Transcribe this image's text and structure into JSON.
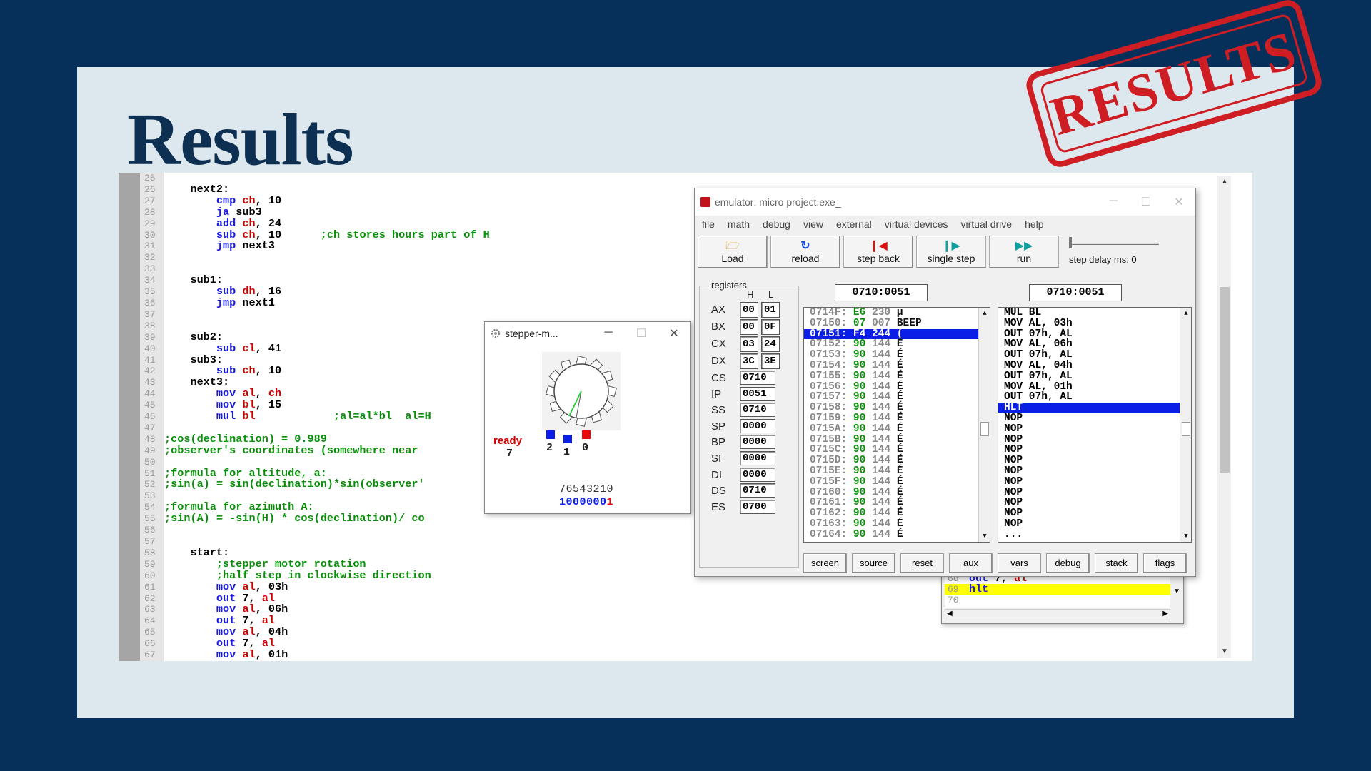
{
  "slide": {
    "title": "Results",
    "stamp": "RESULTS"
  },
  "colors": {
    "background": "#06305a",
    "slide": "#dde7ee",
    "title": "#0d2f52",
    "stamp": "#cf1d24"
  },
  "editor": {
    "lines": [
      {
        "n": "25",
        "parts": []
      },
      {
        "n": "26",
        "parts": [
          [
            "lbl",
            "    next2:"
          ]
        ]
      },
      {
        "n": "27",
        "parts": [
          [
            "txt",
            "        "
          ],
          [
            "kw",
            "cmp"
          ],
          [
            "txt",
            " "
          ],
          [
            "reg",
            "ch"
          ],
          [
            "txt",
            ", 10"
          ]
        ]
      },
      {
        "n": "28",
        "parts": [
          [
            "txt",
            "        "
          ],
          [
            "kw",
            "ja"
          ],
          [
            "txt",
            " sub3"
          ]
        ]
      },
      {
        "n": "29",
        "parts": [
          [
            "txt",
            "        "
          ],
          [
            "kw",
            "add"
          ],
          [
            "txt",
            " "
          ],
          [
            "reg",
            "ch"
          ],
          [
            "txt",
            ", 24"
          ]
        ]
      },
      {
        "n": "30",
        "parts": [
          [
            "txt",
            "        "
          ],
          [
            "kw",
            "sub"
          ],
          [
            "txt",
            " "
          ],
          [
            "reg",
            "ch"
          ],
          [
            "txt",
            ", 10      "
          ],
          [
            "com",
            ";ch stores hours part of H"
          ]
        ]
      },
      {
        "n": "31",
        "parts": [
          [
            "txt",
            "        "
          ],
          [
            "kw",
            "jmp"
          ],
          [
            "txt",
            " next3"
          ]
        ]
      },
      {
        "n": "32",
        "parts": []
      },
      {
        "n": "33",
        "parts": []
      },
      {
        "n": "34",
        "parts": [
          [
            "lbl",
            "    sub1:"
          ]
        ]
      },
      {
        "n": "35",
        "parts": [
          [
            "txt",
            "        "
          ],
          [
            "kw",
            "sub"
          ],
          [
            "txt",
            " "
          ],
          [
            "reg",
            "dh"
          ],
          [
            "txt",
            ", 16"
          ]
        ]
      },
      {
        "n": "36",
        "parts": [
          [
            "txt",
            "        "
          ],
          [
            "kw",
            "jmp"
          ],
          [
            "txt",
            " next1"
          ]
        ]
      },
      {
        "n": "37",
        "parts": []
      },
      {
        "n": "38",
        "parts": []
      },
      {
        "n": "39",
        "parts": [
          [
            "lbl",
            "    sub2:"
          ]
        ]
      },
      {
        "n": "40",
        "parts": [
          [
            "txt",
            "        "
          ],
          [
            "kw",
            "sub"
          ],
          [
            "txt",
            " "
          ],
          [
            "reg",
            "cl"
          ],
          [
            "txt",
            ", 41"
          ]
        ]
      },
      {
        "n": "41",
        "parts": [
          [
            "lbl",
            "    sub3:"
          ]
        ]
      },
      {
        "n": "42",
        "parts": [
          [
            "txt",
            "        "
          ],
          [
            "kw",
            "sub"
          ],
          [
            "txt",
            " "
          ],
          [
            "reg",
            "ch"
          ],
          [
            "txt",
            ", 10"
          ]
        ]
      },
      {
        "n": "43",
        "parts": [
          [
            "lbl",
            "    next3:"
          ]
        ]
      },
      {
        "n": "44",
        "parts": [
          [
            "txt",
            "        "
          ],
          [
            "kw",
            "mov"
          ],
          [
            "txt",
            " "
          ],
          [
            "reg",
            "al"
          ],
          [
            "txt",
            ", "
          ],
          [
            "reg",
            "ch"
          ]
        ]
      },
      {
        "n": "45",
        "parts": [
          [
            "txt",
            "        "
          ],
          [
            "kw",
            "mov"
          ],
          [
            "txt",
            " "
          ],
          [
            "reg",
            "bl"
          ],
          [
            "txt",
            ", 15"
          ]
        ]
      },
      {
        "n": "46",
        "parts": [
          [
            "txt",
            "        "
          ],
          [
            "kw",
            "mul"
          ],
          [
            "txt",
            " "
          ],
          [
            "reg",
            "bl"
          ],
          [
            "txt",
            "            "
          ],
          [
            "com",
            ";al=al*bl  al=H"
          ]
        ]
      },
      {
        "n": "47",
        "parts": []
      },
      {
        "n": "48",
        "parts": [
          [
            "com",
            ";cos(declination) = 0.989"
          ]
        ]
      },
      {
        "n": "49",
        "parts": [
          [
            "com",
            ";observer's coordinates (somewhere near"
          ]
        ]
      },
      {
        "n": "50",
        "parts": []
      },
      {
        "n": "51",
        "parts": [
          [
            "com",
            ";formula for altitude, a:"
          ]
        ]
      },
      {
        "n": "52",
        "parts": [
          [
            "com",
            ";sin(a) = sin(declination)*sin(observer'"
          ]
        ]
      },
      {
        "n": "53",
        "parts": []
      },
      {
        "n": "54",
        "parts": [
          [
            "com",
            ";formula for azimuth A:"
          ]
        ]
      },
      {
        "n": "55",
        "parts": [
          [
            "com",
            ";sin(A) = -sin(H) * cos(declination)/ co"
          ]
        ]
      },
      {
        "n": "56",
        "parts": []
      },
      {
        "n": "57",
        "parts": []
      },
      {
        "n": "58",
        "parts": [
          [
            "lbl",
            "    start:"
          ]
        ]
      },
      {
        "n": "59",
        "parts": [
          [
            "txt",
            "        "
          ],
          [
            "com",
            ";stepper motor rotation"
          ]
        ]
      },
      {
        "n": "60",
        "parts": [
          [
            "txt",
            "        "
          ],
          [
            "com",
            ";half step in clockwise direction"
          ]
        ]
      },
      {
        "n": "61",
        "parts": [
          [
            "txt",
            "        "
          ],
          [
            "kw",
            "mov"
          ],
          [
            "txt",
            " "
          ],
          [
            "reg",
            "al"
          ],
          [
            "txt",
            ", 03h"
          ]
        ]
      },
      {
        "n": "62",
        "parts": [
          [
            "txt",
            "        "
          ],
          [
            "kw",
            "out"
          ],
          [
            "txt",
            " 7, "
          ],
          [
            "reg",
            "al"
          ]
        ]
      },
      {
        "n": "63",
        "parts": [
          [
            "txt",
            "        "
          ],
          [
            "kw",
            "mov"
          ],
          [
            "txt",
            " "
          ],
          [
            "reg",
            "al"
          ],
          [
            "txt",
            ", 06h"
          ]
        ]
      },
      {
        "n": "64",
        "parts": [
          [
            "txt",
            "        "
          ],
          [
            "kw",
            "out"
          ],
          [
            "txt",
            " 7, "
          ],
          [
            "reg",
            "al"
          ]
        ]
      },
      {
        "n": "65",
        "parts": [
          [
            "txt",
            "        "
          ],
          [
            "kw",
            "mov"
          ],
          [
            "txt",
            " "
          ],
          [
            "reg",
            "al"
          ],
          [
            "txt",
            ", 04h"
          ]
        ]
      },
      {
        "n": "66",
        "parts": [
          [
            "txt",
            "        "
          ],
          [
            "kw",
            "out"
          ],
          [
            "txt",
            " 7, "
          ],
          [
            "reg",
            "al"
          ]
        ]
      },
      {
        "n": "67",
        "parts": [
          [
            "txt",
            "        "
          ],
          [
            "kw",
            "mov"
          ],
          [
            "txt",
            " "
          ],
          [
            "reg",
            "al"
          ],
          [
            "txt",
            ", 01h"
          ]
        ]
      },
      {
        "n": "68",
        "parts": [
          [
            "txt",
            "        "
          ],
          [
            "kw",
            "out"
          ],
          [
            "txt",
            " 7, "
          ],
          [
            "reg",
            "al"
          ]
        ]
      },
      {
        "n": "69",
        "parts": [
          [
            "txt",
            "        "
          ],
          [
            "kw",
            "hlt"
          ]
        ]
      }
    ]
  },
  "stepper": {
    "title": "stepper-m...",
    "arrow": "->",
    "status": "ready",
    "status_value": "7",
    "indicators": [
      {
        "label": "2",
        "color": "#0a1ee6"
      },
      {
        "label": "1",
        "color": "#0a1ee6"
      },
      {
        "label": "0",
        "color": "#e60a0a"
      }
    ],
    "bit_positions": "76543210",
    "bit_value_black": "1000000",
    "bit_value_red": "1"
  },
  "emulator": {
    "title": "emulator: micro project.exe_",
    "menu": [
      "file",
      "math",
      "debug",
      "view",
      "external",
      "virtual devices",
      "virtual drive",
      "help"
    ],
    "toolbar": [
      {
        "label": "Load",
        "icon": "open-folder-icon",
        "glyph": "📂"
      },
      {
        "label": "reload",
        "icon": "reload-icon",
        "glyph": "↻"
      },
      {
        "label": "step back",
        "icon": "step-back-icon",
        "glyph": "◀"
      },
      {
        "label": "single step",
        "icon": "single-step-icon",
        "glyph": "▶"
      },
      {
        "label": "run",
        "icon": "run-icon",
        "glyph": "▶"
      }
    ],
    "step_delay": "step delay ms: 0",
    "registers_label": "registers",
    "col_h": "H",
    "col_l": "L",
    "gp_registers": [
      {
        "name": "AX",
        "h": "00",
        "l": "01"
      },
      {
        "name": "BX",
        "h": "00",
        "l": "0F"
      },
      {
        "name": "CX",
        "h": "03",
        "l": "24"
      },
      {
        "name": "DX",
        "h": "3C",
        "l": "3E"
      }
    ],
    "seg_registers": [
      {
        "name": "CS",
        "v": "0710"
      },
      {
        "name": "IP",
        "v": "0051"
      },
      {
        "name": "SS",
        "v": "0710"
      },
      {
        "name": "SP",
        "v": "0000"
      },
      {
        "name": "BP",
        "v": "0000"
      },
      {
        "name": "SI",
        "v": "0000"
      },
      {
        "name": "DI",
        "v": "0000"
      },
      {
        "name": "DS",
        "v": "0710"
      },
      {
        "name": "ES",
        "v": "0700"
      }
    ],
    "addr_left": "0710:0051",
    "addr_right": "0710:0051",
    "memory": [
      [
        "0714F:",
        "E6",
        "230",
        "µ",
        false
      ],
      [
        "07150:",
        "07",
        "007",
        "BEEP",
        false
      ],
      [
        "07151:",
        "F4",
        "244",
        "(",
        true
      ],
      [
        "07152:",
        "90",
        "144",
        "É",
        false
      ],
      [
        "07153:",
        "90",
        "144",
        "É",
        false
      ],
      [
        "07154:",
        "90",
        "144",
        "É",
        false
      ],
      [
        "07155:",
        "90",
        "144",
        "É",
        false
      ],
      [
        "07156:",
        "90",
        "144",
        "É",
        false
      ],
      [
        "07157:",
        "90",
        "144",
        "É",
        false
      ],
      [
        "07158:",
        "90",
        "144",
        "É",
        false
      ],
      [
        "07159:",
        "90",
        "144",
        "É",
        false
      ],
      [
        "0715A:",
        "90",
        "144",
        "É",
        false
      ],
      [
        "0715B:",
        "90",
        "144",
        "É",
        false
      ],
      [
        "0715C:",
        "90",
        "144",
        "É",
        false
      ],
      [
        "0715D:",
        "90",
        "144",
        "É",
        false
      ],
      [
        "0715E:",
        "90",
        "144",
        "É",
        false
      ],
      [
        "0715F:",
        "90",
        "144",
        "É",
        false
      ],
      [
        "07160:",
        "90",
        "144",
        "É",
        false
      ],
      [
        "07161:",
        "90",
        "144",
        "É",
        false
      ],
      [
        "07162:",
        "90",
        "144",
        "É",
        false
      ],
      [
        "07163:",
        "90",
        "144",
        "É",
        false
      ],
      [
        "07164:",
        "90",
        "144",
        "É",
        false
      ]
    ],
    "disasm": [
      [
        "MUL BL",
        false
      ],
      [
        "MOV AL, 03h",
        false
      ],
      [
        "OUT 07h, AL",
        false
      ],
      [
        "MOV AL, 06h",
        false
      ],
      [
        "OUT 07h, AL",
        false
      ],
      [
        "MOV AL, 04h",
        false
      ],
      [
        "OUT 07h, AL",
        false
      ],
      [
        "MOV AL, 01h",
        false
      ],
      [
        "OUT 07h, AL",
        false
      ],
      [
        "HLT",
        true
      ],
      [
        "NOP",
        false
      ],
      [
        "NOP",
        false
      ],
      [
        "NOP",
        false
      ],
      [
        "NOP",
        false
      ],
      [
        "NOP",
        false
      ],
      [
        "NOP",
        false
      ],
      [
        "NOP",
        false
      ],
      [
        "NOP",
        false
      ],
      [
        "NOP",
        false
      ],
      [
        "NOP",
        false
      ],
      [
        "NOP",
        false
      ],
      [
        "...",
        false
      ]
    ],
    "bottom_buttons": [
      "screen",
      "source",
      "reset",
      "aux",
      "vars",
      "debug",
      "stack",
      "flags"
    ]
  },
  "source_window": {
    "lines": [
      {
        "n": "68",
        "kw": "out",
        "rest": " 7, ",
        "reg": "al",
        "hl": false
      },
      {
        "n": "69",
        "kw": "hlt",
        "rest": "",
        "reg": "",
        "hl": true
      },
      {
        "n": "70",
        "kw": "",
        "rest": "",
        "reg": "",
        "hl": false
      }
    ]
  }
}
